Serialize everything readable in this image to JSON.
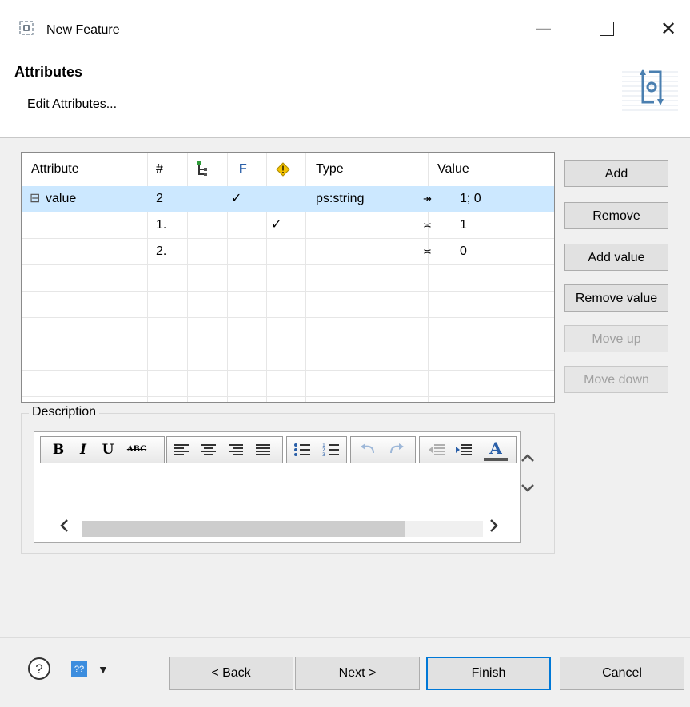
{
  "window": {
    "title": "New Feature",
    "minimize_glyph": "—",
    "close_glyph": "✕"
  },
  "header": {
    "title": "Attributes",
    "subtitle": "Edit Attributes..."
  },
  "table": {
    "columns": [
      "Attribute",
      "#",
      "",
      "F",
      "",
      "Type",
      "Value"
    ],
    "column_icons": {
      "2": "tree-icon",
      "4": "warning-icon"
    },
    "rows": [
      {
        "toggle": "⊟",
        "attribute": "value",
        "num": "2",
        "f": "✓",
        "warn": "",
        "type": "ps:string",
        "value_icon": "calculated-value-icon",
        "value_glyph": "↠",
        "value": "1; 0",
        "selected": true
      },
      {
        "toggle": "",
        "attribute": "",
        "num": "1.",
        "f": "",
        "warn": "✓",
        "type": "",
        "value_icon": "constant-value-icon",
        "value_glyph": "≍",
        "value": "1",
        "selected": false
      },
      {
        "toggle": "",
        "attribute": "",
        "num": "2.",
        "f": "",
        "warn": "",
        "type": "",
        "value_icon": "constant-value-icon",
        "value_glyph": "≍",
        "value": "0",
        "selected": false
      }
    ]
  },
  "actions": {
    "add": "Add",
    "remove": "Remove",
    "add_value": "Add value",
    "remove_value": "Remove value",
    "move_up": "Move up",
    "move_down": "Move down"
  },
  "description": {
    "label": "Description",
    "toolbar": {
      "bold": "B",
      "italic": "I",
      "underline": "U",
      "strike": "ABC",
      "font_color": "A"
    }
  },
  "footer": {
    "back": "< Back",
    "next": "Next >",
    "finish": "Finish",
    "cancel": "Cancel",
    "help_glyph": "?",
    "tip_glyph": "??"
  },
  "colors": {
    "selection": "#cce8ff",
    "default_button_border": "#0078d7",
    "column_F": "#2a5fa8",
    "warning": "#f2c200"
  }
}
